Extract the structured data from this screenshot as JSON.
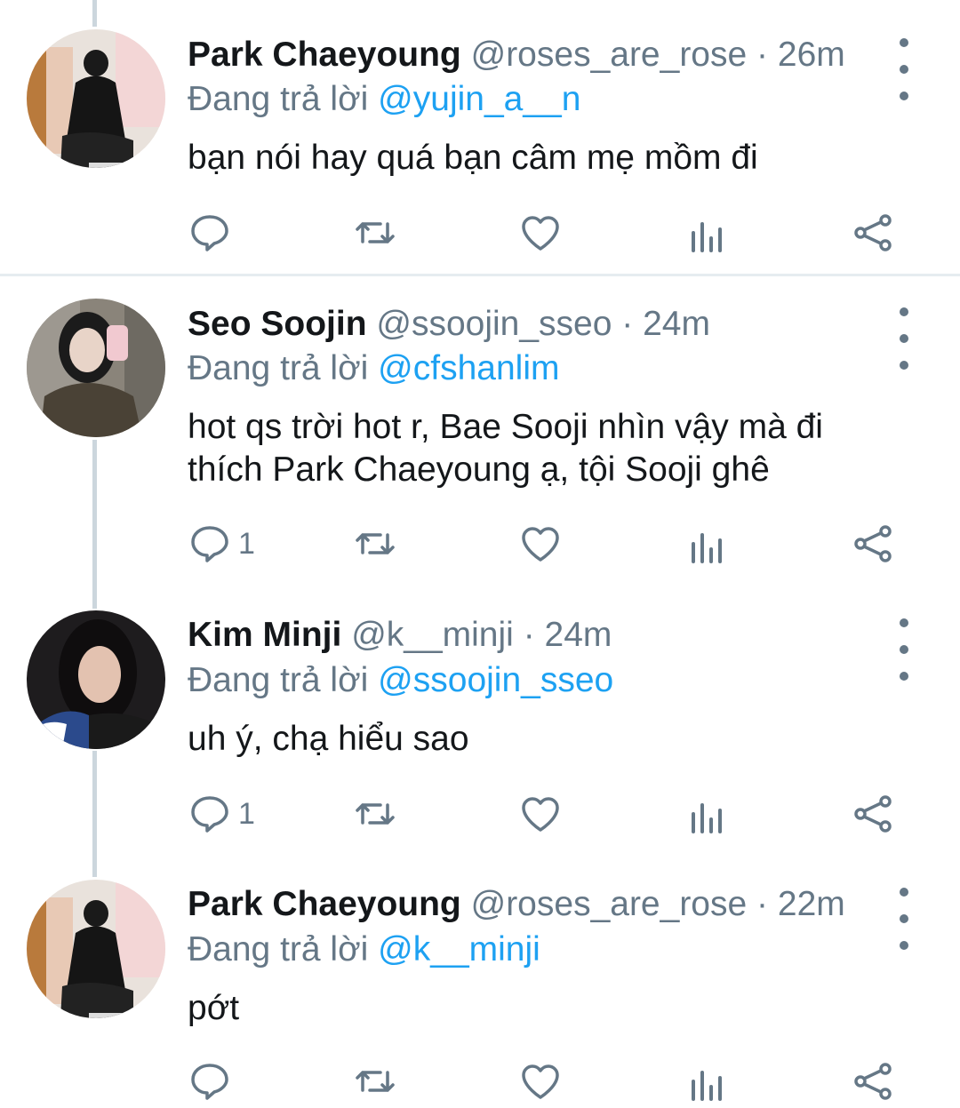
{
  "tweets": [
    {
      "name": "Park Chaeyoung",
      "handle": "@roses_are_rose",
      "separator": "·",
      "time": "26m",
      "replying_prefix": "Đang trả lời",
      "replying_to": "@yujin_a__n",
      "text": "bạn nói hay quá bạn câm mẹ mồm đi",
      "reply_count": "",
      "avatar": "avatar-park-chaeyoung"
    },
    {
      "name": "Seo Soojin",
      "handle": "@ssoojin_sseo",
      "separator": "·",
      "time": "24m",
      "replying_prefix": "Đang trả lời",
      "replying_to": "@cfshanlim",
      "text": "hot qs trời hot r, Bae Sooji nhìn vậy mà đi thích Park Chaeyoung ạ, tội Sooji ghê",
      "reply_count": "1",
      "avatar": "avatar-seo-soojin"
    },
    {
      "name": "Kim Minji",
      "handle": "@k__minji",
      "separator": "·",
      "time": "24m",
      "replying_prefix": "Đang trả lời",
      "replying_to": "@ssoojin_sseo",
      "text": "uh ý, chạ hiểu sao",
      "reply_count": "1",
      "avatar": "avatar-kim-minji"
    },
    {
      "name": "Park Chaeyoung",
      "handle": "@roses_are_rose",
      "separator": "·",
      "time": "22m",
      "replying_prefix": "Đang trả lời",
      "replying_to": "@k__minji",
      "text": "pớt",
      "reply_count": "",
      "avatar": "avatar-park-chaeyoung"
    }
  ],
  "icons": {
    "reply": "reply-icon",
    "retweet": "retweet-icon",
    "like": "heart-icon",
    "analytics": "analytics-icon",
    "share": "share-icon",
    "more": "more-vertical-icon"
  },
  "colors": {
    "accent": "#1da1f2",
    "secondary_text": "#657786",
    "icon": "#657786",
    "thread_line": "#ccd6dd"
  }
}
